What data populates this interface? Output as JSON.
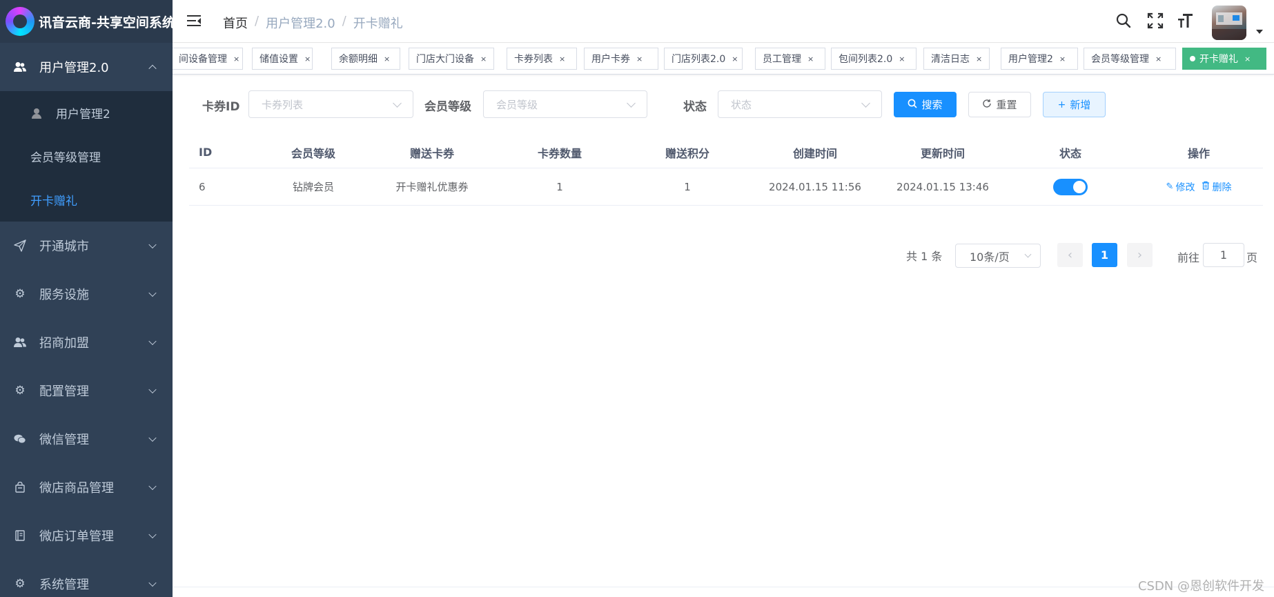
{
  "app": {
    "title": "讯音云商-共享空间系统"
  },
  "sidebar": {
    "groups": [
      {
        "label": "用户管理2.0",
        "icon": "user-group-icon",
        "open": true,
        "children": [
          {
            "label": "用户管理2"
          },
          {
            "label": "会员等级管理"
          },
          {
            "label": "开卡赠礼",
            "active": true
          }
        ]
      },
      {
        "label": "开通城市",
        "icon": "paper-plane-icon"
      },
      {
        "label": "服务设施",
        "icon": "gear-icon"
      },
      {
        "label": "招商加盟",
        "icon": "user-group-icon"
      },
      {
        "label": "配置管理",
        "icon": "gear-icon"
      },
      {
        "label": "微信管理",
        "icon": "wechat-icon"
      },
      {
        "label": "微店商品管理",
        "icon": "shopping-bag-icon"
      },
      {
        "label": "微店订单管理",
        "icon": "book-icon"
      },
      {
        "label": "系统管理",
        "icon": "gear-icon"
      }
    ]
  },
  "header": {
    "breadcrumb": {
      "home": "首页",
      "parent": "用户管理2.0",
      "current": "开卡赠礼"
    },
    "icons": [
      "search-icon",
      "fullscreen-icon",
      "font-size-icon"
    ]
  },
  "tags": [
    {
      "label": "间设备管理"
    },
    {
      "label": "储值设置"
    },
    {
      "label": "余额明细"
    },
    {
      "label": "门店大门设备"
    },
    {
      "label": "卡券列表"
    },
    {
      "label": "用户卡券"
    },
    {
      "label": "门店列表2.0"
    },
    {
      "label": "员工管理"
    },
    {
      "label": "包间列表2.0"
    },
    {
      "label": "清洁日志"
    },
    {
      "label": "用户管理2"
    },
    {
      "label": "会员等级管理"
    },
    {
      "label": "开卡赠礼",
      "active": true
    }
  ],
  "tag_close": "×",
  "filters": {
    "card_id": {
      "label": "卡券ID",
      "placeholder": "卡券列表"
    },
    "member_level": {
      "label": "会员等级",
      "placeholder": "会员等级"
    },
    "status": {
      "label": "状态",
      "placeholder": "状态"
    },
    "search_btn": "搜索",
    "reset_btn": "重置",
    "add_btn": "新增"
  },
  "table": {
    "columns": [
      "ID",
      "会员等级",
      "赠送卡券",
      "卡券数量",
      "赠送积分",
      "创建时间",
      "更新时间",
      "状态",
      "操作"
    ],
    "rows": [
      {
        "id": "6",
        "level": "钻牌会员",
        "coupon": "开卡赠礼优惠券",
        "count": "1",
        "points": "1",
        "created": "2024.01.15 11:56",
        "updated": "2024.01.15 13:46",
        "status_on": true,
        "edit": "修改",
        "delete": "删除"
      }
    ]
  },
  "pagination": {
    "total": "共 1 条",
    "page_size": "10条/页",
    "current": "1",
    "goto_label": "前往",
    "goto_value": "1",
    "page_label": "页"
  },
  "watermark": "CSDN @恩创软件开发",
  "colors": {
    "sidebar": "#304156",
    "submenu": "#1f2d3d",
    "accent": "#1890ff",
    "active_tag": "#42b983"
  }
}
